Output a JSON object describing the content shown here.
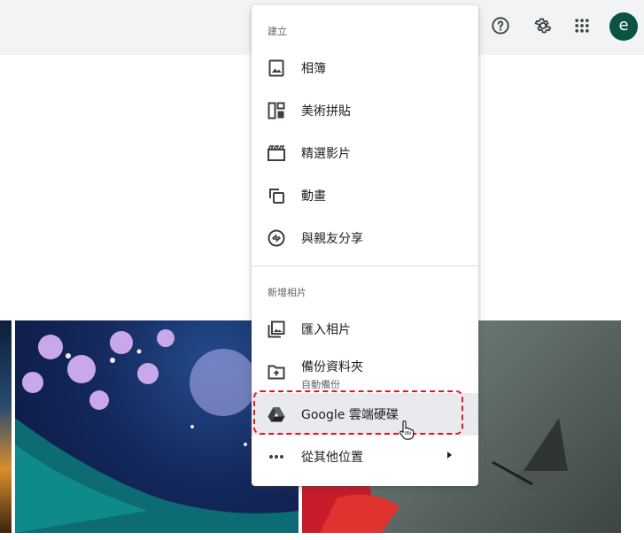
{
  "header": {
    "icons": [
      "help-icon",
      "settings-icon",
      "apps-icon"
    ],
    "avatar_letter": "e"
  },
  "menu": {
    "create_section": {
      "title": "建立",
      "items": [
        {
          "label": "相簿",
          "icon": "album-icon"
        },
        {
          "label": "美術拼貼",
          "icon": "collage-icon"
        },
        {
          "label": "精選影片",
          "icon": "movie-icon"
        },
        {
          "label": "動畫",
          "icon": "animation-icon"
        },
        {
          "label": "與親友分享",
          "icon": "share-icon"
        }
      ]
    },
    "add_section": {
      "title": "新增相片",
      "items": [
        {
          "label": "匯入相片",
          "icon": "import-photos-icon"
        },
        {
          "label": "備份資料夾",
          "sublabel": "自動備份",
          "icon": "backup-folder-icon"
        },
        {
          "label": "Google 雲端硬碟",
          "icon": "google-drive-icon"
        },
        {
          "label": "從其他位置",
          "icon": "more-horiz-icon"
        }
      ]
    }
  },
  "colors": {
    "accent_highlight": "#e0182a",
    "avatar_bg": "#0b5345",
    "topbar_bg": "#f1f3f4"
  }
}
